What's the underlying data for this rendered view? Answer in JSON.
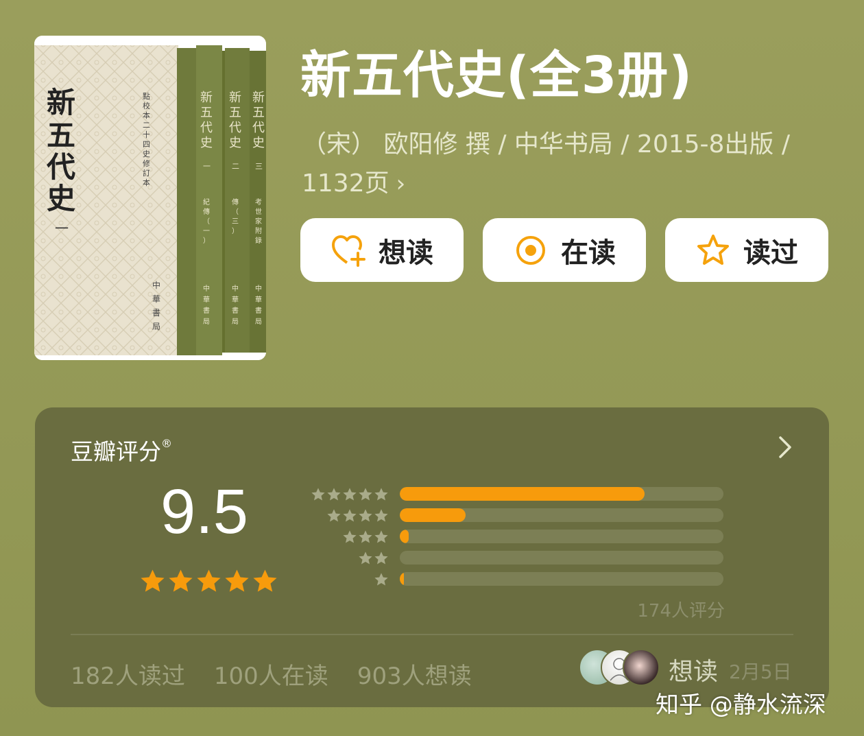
{
  "book": {
    "title": "新五代史(全3册)",
    "meta_line1": "（宋） 欧阳修 撰 / 中华书局 / 2015-8出版 /",
    "meta_line2": "1132页",
    "cover_title": "新五代史",
    "cover_volume": "一",
    "cover_series": "點校本二十四史修訂本",
    "spines": [
      {
        "title": "新五代史",
        "vol": "一",
        "sub": "紀傳（一）",
        "publisher": "中華書局"
      },
      {
        "title": "新五代史",
        "vol": "二",
        "sub": "傳（三）",
        "publisher": "中華書局"
      },
      {
        "title": "新五代史",
        "vol": "三",
        "sub": "考世家附錄",
        "publisher": "中華書局"
      }
    ],
    "cover_publisher": "中華書局"
  },
  "actions": {
    "want": "想读",
    "reading": "在读",
    "read": "读过"
  },
  "rating": {
    "title": "豆瓣评分",
    "registered": "®",
    "score": "9.5",
    "score_stars": 5,
    "distribution": [
      {
        "stars": 5,
        "fraction": 0.757
      },
      {
        "stars": 4,
        "fraction": 0.203
      },
      {
        "stars": 3,
        "fraction": 0.028
      },
      {
        "stars": 2,
        "fraction": 0.0
      },
      {
        "stars": 1,
        "fraction": 0.012
      }
    ],
    "count_text": "174人评分"
  },
  "stats": {
    "read": "182人读过",
    "reading": "100人在读",
    "want": "903人想读"
  },
  "activity": {
    "label": "想读",
    "date": "2月5日"
  },
  "watermark": "知乎 @静水流深",
  "colors": {
    "background": "#9a9e5c",
    "card": "#6a6d40",
    "accent": "#f79b0c",
    "button_bg": "#ffffff"
  }
}
